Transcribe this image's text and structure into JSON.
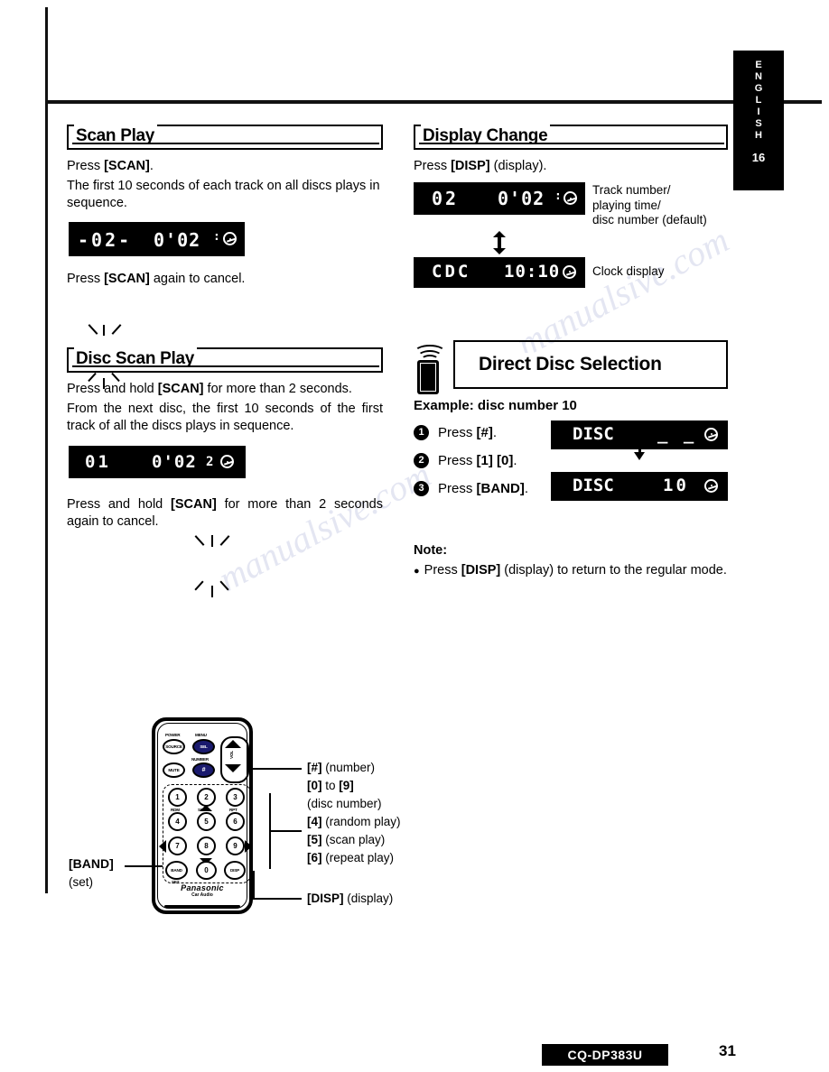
{
  "sidebar": {
    "language": "ENGLISH",
    "letters": [
      "E",
      "N",
      "G",
      "L",
      "I",
      "S",
      "H"
    ],
    "number": "16"
  },
  "sections": {
    "scan_play": {
      "title": "Scan Play",
      "line1_prefix": "Press ",
      "line1_key": "[SCAN]",
      "line1_suffix": ".",
      "body": "The first 10 seconds of each track on all discs plays in sequence.",
      "lcd": {
        "track": "-02-",
        "time": "0'02",
        "colon": ":",
        "disc_icon": "disc-icon"
      },
      "cancel_prefix": "Press ",
      "cancel_key": "[SCAN]",
      "cancel_suffix": " again to cancel."
    },
    "disc_scan_play": {
      "title": "Disc Scan Play",
      "line1_prefix": "Press and hold ",
      "line1_key": "[SCAN]",
      "line1_suffix": " for more than 2 seconds.",
      "body": "From the next disc, the first 10 seconds of the first track of all the discs plays in sequence.",
      "lcd": {
        "track": "01",
        "time": "0'02",
        "disc": "2",
        "disc_icon": "disc-icon"
      },
      "cancel_prefix": "Press and hold ",
      "cancel_key": "[SCAN]",
      "cancel_suffix": " for more than 2 seconds again to cancel."
    },
    "display_change": {
      "title": "Display Change",
      "line1_prefix": "Press ",
      "line1_key": "[DISP]",
      "line1_suffix": " (display).",
      "lcd_top": {
        "track": "02",
        "time": "0'02",
        "colon": ":",
        "disc_icon": "disc-icon"
      },
      "caption_top": "Track number/ playing time/ disc number (default)",
      "caption_top_lines": [
        "Track number/",
        "playing time/",
        "disc number (default)"
      ],
      "lcd_bottom": {
        "text": "CDC",
        "clock": "10:10",
        "disc_icon": "disc-icon"
      },
      "caption_bottom": "Clock display",
      "toggle_icon": "up-down-arrow-icon"
    },
    "direct_disc_selection": {
      "title": "Direct Disc Selection",
      "remote_icon": "remote-control-icon",
      "example": "Example: disc number 10",
      "steps": [
        {
          "num": "1",
          "prefix": "Press ",
          "key": "[#]",
          "suffix": "."
        },
        {
          "num": "2",
          "prefix": "Press ",
          "key": "[1] [0]",
          "suffix": "."
        },
        {
          "num": "3",
          "prefix": "Press ",
          "key": "[BAND]",
          "suffix": "."
        }
      ],
      "lcd_top": {
        "label": "DISC",
        "value": "_ _",
        "disc_icon": "disc-icon"
      },
      "lcd_bottom": {
        "label": "DISC",
        "value": "10",
        "disc_icon": "disc-icon"
      },
      "arrow_icon": "down-arrow-icon",
      "note_title": "Note:",
      "note_bullet": "●",
      "note_prefix": "Press ",
      "note_key": "[DISP]",
      "note_suffix": " (display) to return to the regular mode."
    }
  },
  "remote_diagram": {
    "brand": "Panasonic",
    "brand_sub": "Car Audio",
    "top_labels": {
      "power": "POWER",
      "menu": "MENU",
      "number": "NUMBER",
      "vol": "VOL"
    },
    "buttons": {
      "source": "SOURCE",
      "sel": "SEL",
      "mute": "MUTE",
      "hash": "#",
      "band": "BAND",
      "set": "SET",
      "disp": "DISP",
      "zero": "0",
      "digits": [
        "1",
        "2",
        "3",
        "4",
        "5",
        "6",
        "7",
        "8",
        "9"
      ],
      "digit_subs": [
        "RDM",
        "SCAN",
        "RPT"
      ]
    },
    "callouts": [
      {
        "key": "[#]",
        "desc": " (number)"
      },
      {
        "key": "[0]",
        "desc": " to ",
        "key2": "[9]"
      },
      {
        "key": "",
        "desc": "(disc number)"
      },
      {
        "key": "[4]",
        "desc": " (random play)"
      },
      {
        "key": "[5]",
        "desc": " (scan play)"
      },
      {
        "key": "[6]",
        "desc": " (repeat play)"
      },
      {
        "key": "[DISP]",
        "desc": " (display)"
      }
    ],
    "band_callout_key": "[BAND]",
    "band_callout_sub": "(set)"
  },
  "footer": {
    "model": "CQ-DP383U",
    "page": "31"
  },
  "watermarks": [
    "manualsive.com",
    "manualsive.com"
  ]
}
